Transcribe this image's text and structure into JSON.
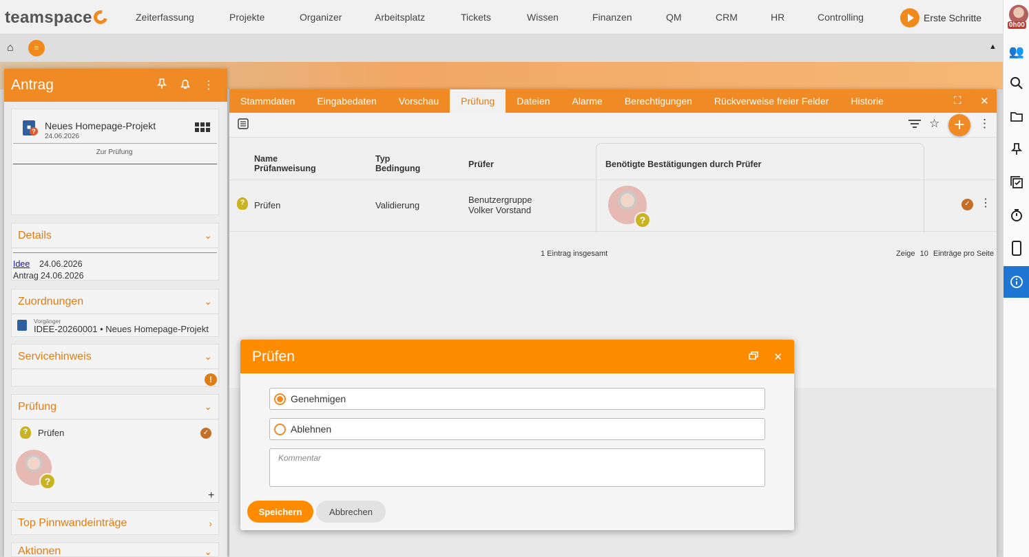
{
  "app": {
    "logo": "teamspace",
    "nav": [
      "Zeiterfassung",
      "Projekte",
      "Organizer",
      "Arbeitsplatz",
      "Tickets",
      "Wissen",
      "Finanzen",
      "QM",
      "CRM",
      "HR",
      "Controlling"
    ],
    "erste_schritte": "Erste Schritte",
    "time_badge": "0h00",
    "accent": "#ef8a24",
    "info_blue": "#1e76d2"
  },
  "left": {
    "title": "Antrag",
    "project": {
      "name": "Neues Homepage-Projekt",
      "date": "24.06.2026",
      "status": "Zur Prüfung"
    },
    "details": {
      "title": "Details",
      "rows": [
        {
          "label": "Idee",
          "value": "24.06.2026"
        },
        {
          "label": "Antrag",
          "value": "24.06.2026"
        }
      ]
    },
    "zuordnungen": {
      "title": "Zuordnungen",
      "kind": "Vorgänger",
      "value": "IDEE-20260001 • Neues Homepage-Projekt"
    },
    "servicehinweis": {
      "title": "Servicehinweis"
    },
    "pruefung": {
      "title": "Prüfung",
      "item": "Prüfen"
    },
    "pinnwand": {
      "title": "Top Pinnwandeinträge"
    },
    "aktionen": {
      "title": "Aktionen"
    }
  },
  "main": {
    "tabs": [
      "Stammdaten",
      "Eingabedaten",
      "Vorschau",
      "Prüfung",
      "Dateien",
      "Alarme",
      "Berechtigungen",
      "Rückverweise freier Felder",
      "Historie"
    ],
    "active_tab": "Prüfung",
    "headers": {
      "name": "Name",
      "pruefanweisung": "Prüfanweisung",
      "typ": "Typ",
      "bedingung": "Bedingung",
      "pruefer": "Prüfer",
      "bestaetigungen": "Benötigte Bestätigungen durch Prüfer"
    },
    "row": {
      "name": "Prüfen",
      "typ": "Validierung",
      "pruefer_1": "Benutzergruppe",
      "pruefer_2": "Volker Vorstand"
    },
    "footer": {
      "total": "1 Eintrag insgesamt",
      "zeige": "Zeige",
      "per_page": "10",
      "per_page_suffix": "Einträge pro Seite"
    }
  },
  "dialog": {
    "title": "Prüfen",
    "options": [
      {
        "label": "Genehmigen",
        "selected": true
      },
      {
        "label": "Ablehnen",
        "selected": false
      }
    ],
    "comment_placeholder": "Kommentar",
    "save": "Speichern",
    "cancel": "Abbrechen"
  }
}
